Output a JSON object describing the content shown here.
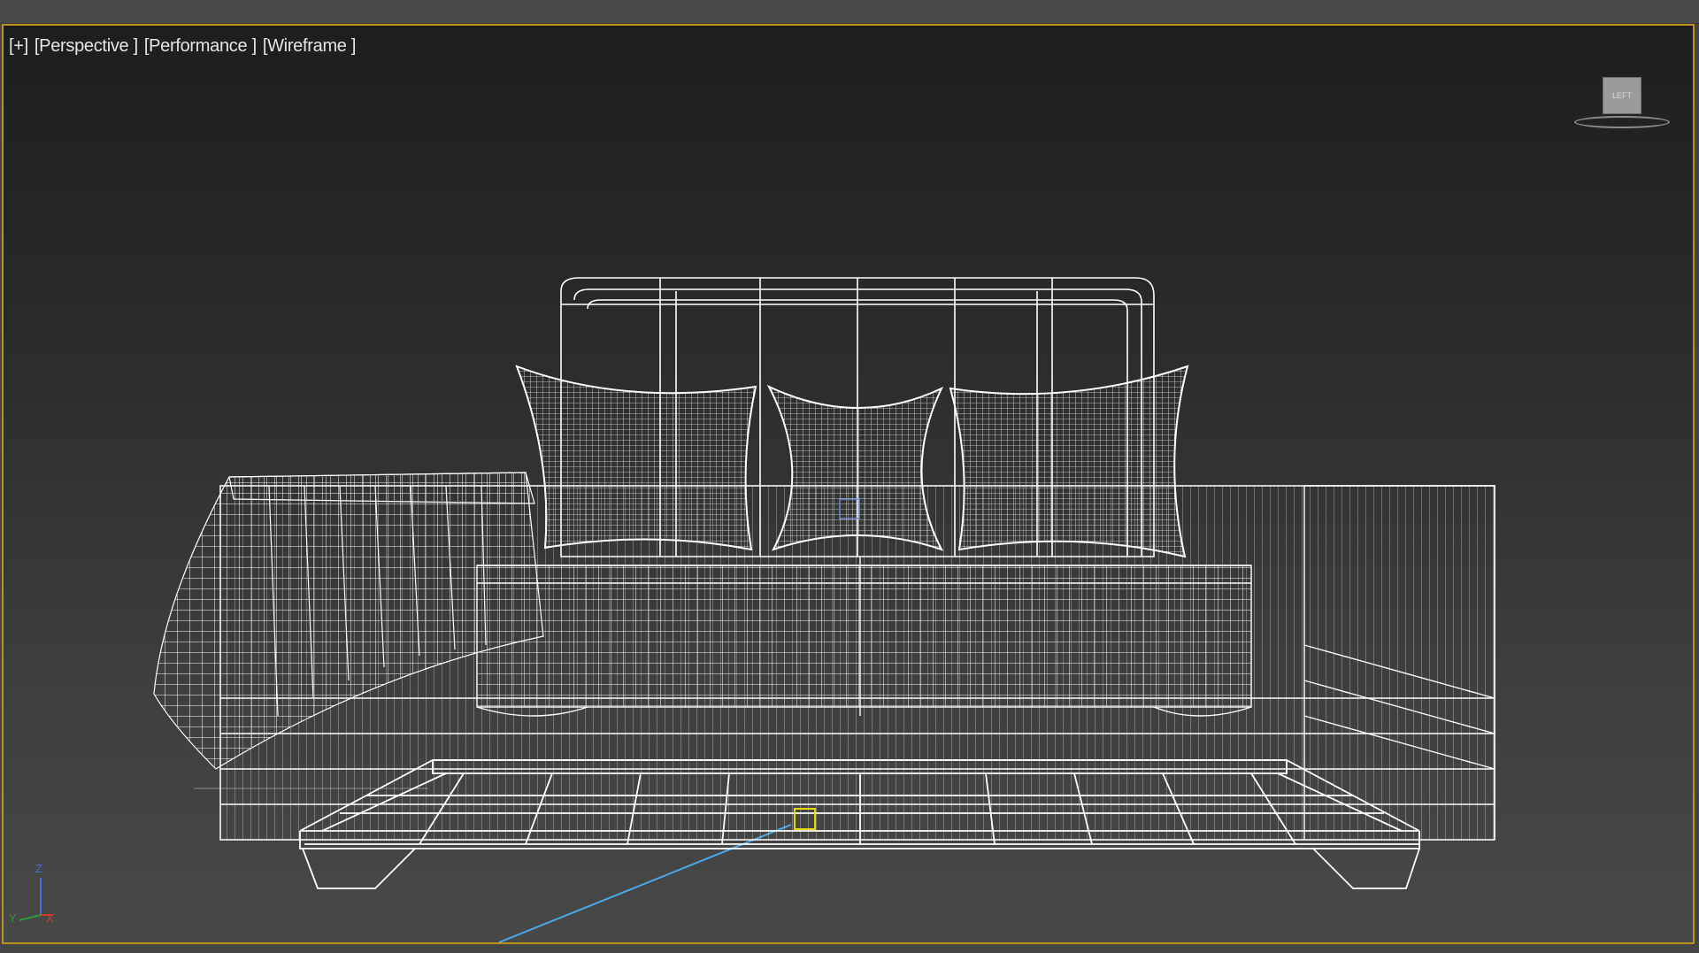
{
  "viewport": {
    "menu": {
      "plus": "[+]",
      "view": "[Perspective ]",
      "mode": "[Performance ]",
      "shading": "[Wireframe ]"
    },
    "viewcube": {
      "face_label": "LEFT"
    },
    "axes": {
      "z": "Z",
      "x": "X",
      "y": "Y"
    },
    "colors": {
      "active_border": "#b8941e",
      "wire": "#ffffff",
      "axis_z": "#4a6fd8",
      "axis_x": "#d23a2a",
      "axis_y": "#2f9a3a",
      "pivot": "#e8d800",
      "helper_line": "#4aa8e8"
    }
  }
}
